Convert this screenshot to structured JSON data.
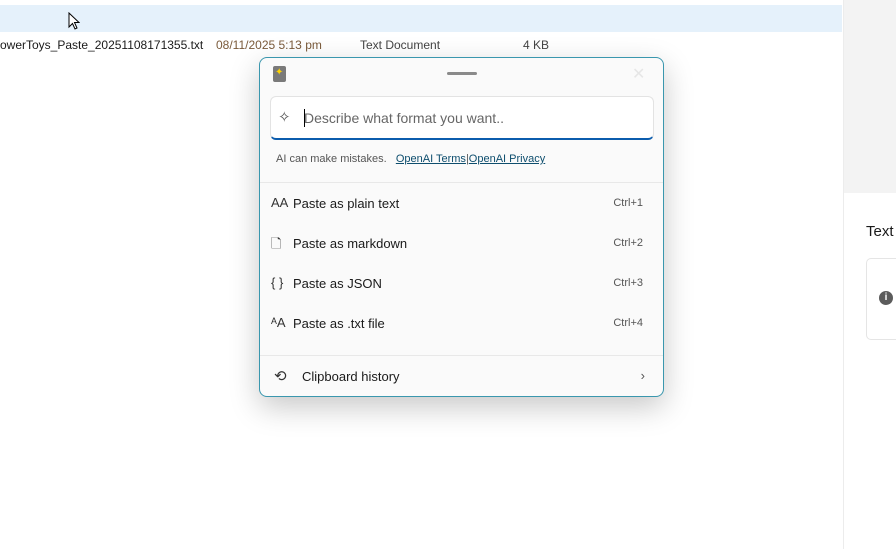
{
  "explorer": {
    "file_name": "owerToys_Paste_20251108171355.txt",
    "date": "08/11/2025 5:13 pm",
    "type": "Text Document",
    "size": "4 KB"
  },
  "right_panel": {
    "title": "Text",
    "info_icon": "info-icon"
  },
  "popup": {
    "input_placeholder": "Describe what format you want..",
    "disclaimer": "AI can make mistakes.",
    "terms_link": "OpenAI Terms",
    "separator": "|",
    "privacy_link": "OpenAI Privacy",
    "items": [
      {
        "icon": "AA",
        "label": "Paste as plain text",
        "shortcut": "Ctrl+1"
      },
      {
        "icon": "🗋",
        "label": "Paste as markdown",
        "shortcut": "Ctrl+2"
      },
      {
        "icon": "{ }",
        "label": "Paste as JSON",
        "shortcut": "Ctrl+3"
      },
      {
        "icon": "ᴬA",
        "label": "Paste as .txt file",
        "shortcut": "Ctrl+4"
      }
    ],
    "history": {
      "label": "Clipboard history",
      "chevron": "›",
      "icon": "⟲"
    }
  },
  "colors": {
    "accent": "#0b5cad",
    "border": "#3a97ae",
    "highlight": "#e5f1fb"
  }
}
